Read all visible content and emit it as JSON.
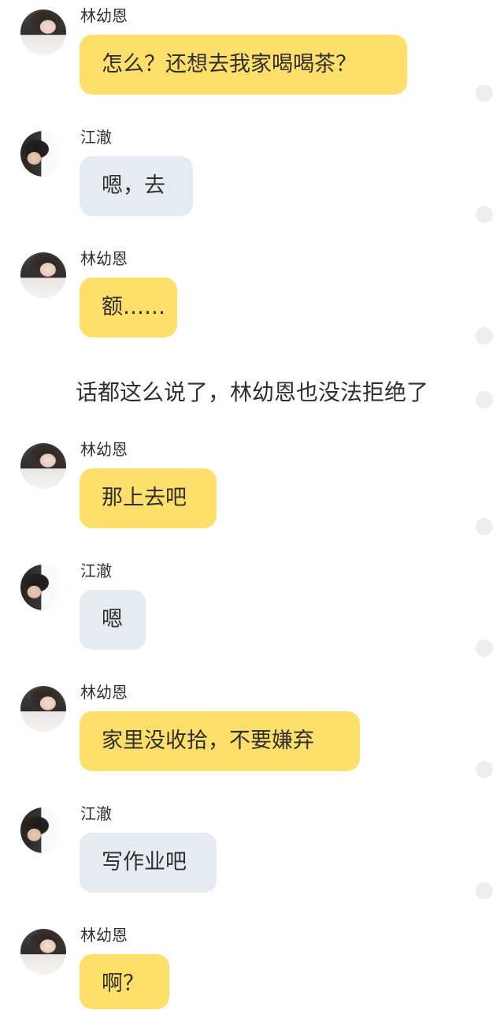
{
  "characters": {
    "lin": {
      "name": "林幼恩",
      "avatar_icon": "girl-avatar-icon",
      "bubble_color": "#ffdf6c"
    },
    "jiang": {
      "name": "江澈",
      "avatar_icon": "boy-avatar-icon",
      "bubble_color": "#e6ebf2"
    }
  },
  "messages": [
    {
      "sender": "林幼恩",
      "text": "怎么？还想去我家喝喝茶？"
    },
    {
      "sender": "江澈",
      "text": "嗯，去"
    },
    {
      "sender": "林幼恩",
      "text": "额……"
    },
    {
      "sender": "林幼恩",
      "text": "那上去吧"
    },
    {
      "sender": "江澈",
      "text": "嗯"
    },
    {
      "sender": "林幼恩",
      "text": "家里没收拾，不要嫌弃"
    },
    {
      "sender": "江澈",
      "text": "写作业吧"
    },
    {
      "sender": "林幼恩",
      "text": "啊？"
    }
  ],
  "narration": "话都这么说了，林幼恩也没法拒绝了"
}
